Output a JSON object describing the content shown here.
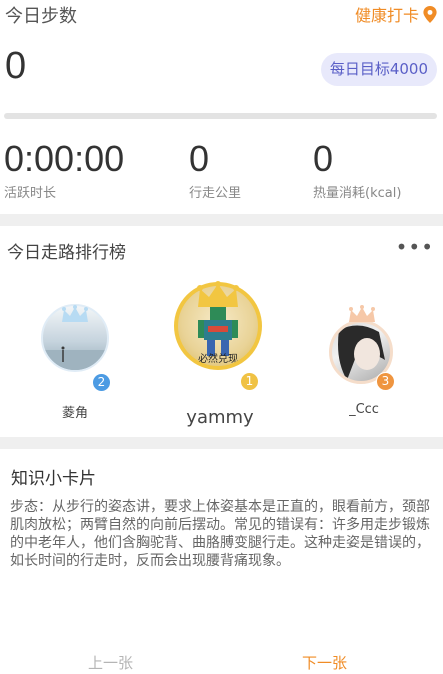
{
  "header": {
    "title": "今日步数",
    "checkin_label": "健康打卡"
  },
  "steps": {
    "value": "0",
    "goal_label": "每日目标4000",
    "progress_fraction": 0
  },
  "stats": [
    {
      "value": "0:00:00",
      "label": "活跃时长"
    },
    {
      "value": "0",
      "label": "行走公里"
    },
    {
      "value": "0",
      "label": "热量消耗(kcal)"
    }
  ],
  "ranking": {
    "title": "今日走路排行榜",
    "more_icon": "more-dots-icon",
    "entries": [
      {
        "rank": "2",
        "name": "菱角"
      },
      {
        "rank": "1",
        "name": "yammy",
        "avatar_caption": "必然兑现"
      },
      {
        "rank": "3",
        "name": "_Ccc"
      }
    ]
  },
  "card": {
    "title": "知识小卡片",
    "text": "步态：从步行的姿态讲，要求上体姿基本是正直的，眼看前方，颈部肌肉放松；两臂自然的向前后摆动。常见的错误有：许多用走步锻炼的中老年人，他们含胸驼背、曲胳膊变腿行走。这种走姿是错误的，如长时间的行走时，反而会出现腰背痛现象。"
  },
  "nav": {
    "prev_label": "上一张",
    "next_label": "下一张"
  },
  "colors": {
    "accent": "#f08c26",
    "goal": "#5a5fc7",
    "rank1": "#f2c641",
    "rank2": "#4c9be3",
    "rank3": "#ef9540"
  }
}
